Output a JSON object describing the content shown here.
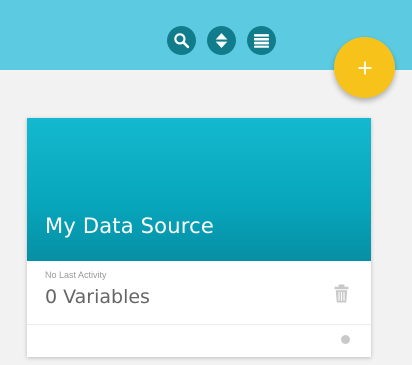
{
  "toolbar": {
    "icons": [
      "search-icon",
      "sort-icon",
      "list-icon"
    ],
    "background": "#5ccbe1",
    "icon_color": "#107c8c"
  },
  "fab": {
    "icon": "plus-icon",
    "color": "#f7c31b"
  },
  "card": {
    "title": "My Data Source",
    "last_activity": "No Last Activity",
    "variables_label": "0 Variables",
    "header_color": "#07a5bb",
    "actions": [
      "trash-icon"
    ],
    "status": "inactive"
  }
}
